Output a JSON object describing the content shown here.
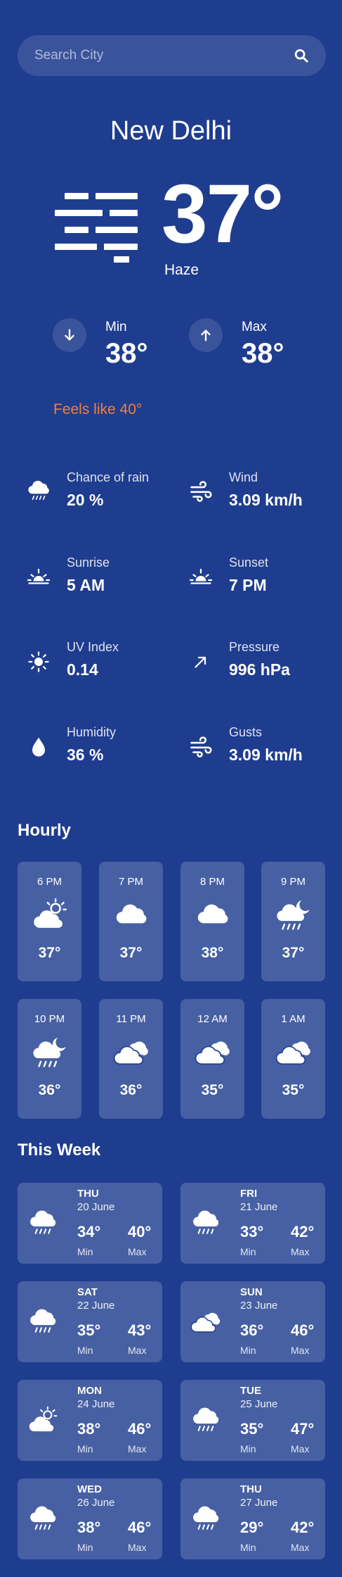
{
  "search": {
    "placeholder": "Search City",
    "icon": "search-icon"
  },
  "current": {
    "city": "New Delhi",
    "temp": "37°",
    "condition": "Haze",
    "icon": "haze-icon",
    "min_label": "Min",
    "min_value": "38°",
    "max_label": "Max",
    "max_value": "38°",
    "feels_like": "Feels like 40°"
  },
  "colors": {
    "background": "#1f3d8f",
    "feels_like": "#f57f33",
    "card": "rgba(255,255,255,0.18)"
  },
  "details": [
    {
      "label": "Chance of rain",
      "value": "20 %",
      "icon": "rain-cloud-icon"
    },
    {
      "label": "Wind",
      "value": "3.09 km/h",
      "icon": "wind-icon"
    },
    {
      "label": "Sunrise",
      "value": "5 AM",
      "icon": "sunrise-icon"
    },
    {
      "label": "Sunset",
      "value": "7 PM",
      "icon": "sunset-icon"
    },
    {
      "label": "UV Index",
      "value": "0.14",
      "icon": "sun-icon"
    },
    {
      "label": "Pressure",
      "value": "996 hPa",
      "icon": "arrow-up-right-icon"
    },
    {
      "label": "Humidity",
      "value": "36 %",
      "icon": "droplet-icon"
    },
    {
      "label": "Gusts",
      "value": "3.09 km/h",
      "icon": "wind-icon"
    }
  ],
  "hourly": {
    "title": "Hourly",
    "items": [
      {
        "time": "6 PM",
        "temp": "37°",
        "icon": "sun-cloud-icon"
      },
      {
        "time": "7 PM",
        "temp": "37°",
        "icon": "cloud-icon"
      },
      {
        "time": "8 PM",
        "temp": "38°",
        "icon": "cloud-icon"
      },
      {
        "time": "9 PM",
        "temp": "37°",
        "icon": "moon-rain-cloud-icon"
      },
      {
        "time": "10 PM",
        "temp": "36°",
        "icon": "moon-rain-cloud-icon"
      },
      {
        "time": "11 PM",
        "temp": "36°",
        "icon": "clouds-icon"
      },
      {
        "time": "12 AM",
        "temp": "35°",
        "icon": "clouds-icon"
      },
      {
        "time": "1 AM",
        "temp": "35°",
        "icon": "clouds-icon"
      }
    ]
  },
  "week": {
    "title": "This Week",
    "min_label": "Min",
    "max_label": "Max",
    "days": [
      {
        "day": "THU",
        "date": "20 June",
        "min": "34°",
        "max": "40°",
        "icon": "rain-cloud-icon"
      },
      {
        "day": "FRI",
        "date": "21 June",
        "min": "33°",
        "max": "42°",
        "icon": "rain-cloud-icon"
      },
      {
        "day": "SAT",
        "date": "22 June",
        "min": "35°",
        "max": "43°",
        "icon": "rain-cloud-icon"
      },
      {
        "day": "SUN",
        "date": "23 June",
        "min": "36°",
        "max": "46°",
        "icon": "clouds-icon"
      },
      {
        "day": "MON",
        "date": "24 June",
        "min": "38°",
        "max": "46°",
        "icon": "sun-cloud-icon"
      },
      {
        "day": "TUE",
        "date": "25 June",
        "min": "35°",
        "max": "47°",
        "icon": "rain-cloud-icon"
      },
      {
        "day": "WED",
        "date": "26 June",
        "min": "38°",
        "max": "46°",
        "icon": "rain-cloud-icon"
      },
      {
        "day": "THU",
        "date": "27 June",
        "min": "29°",
        "max": "42°",
        "icon": "rain-cloud-icon"
      }
    ]
  }
}
